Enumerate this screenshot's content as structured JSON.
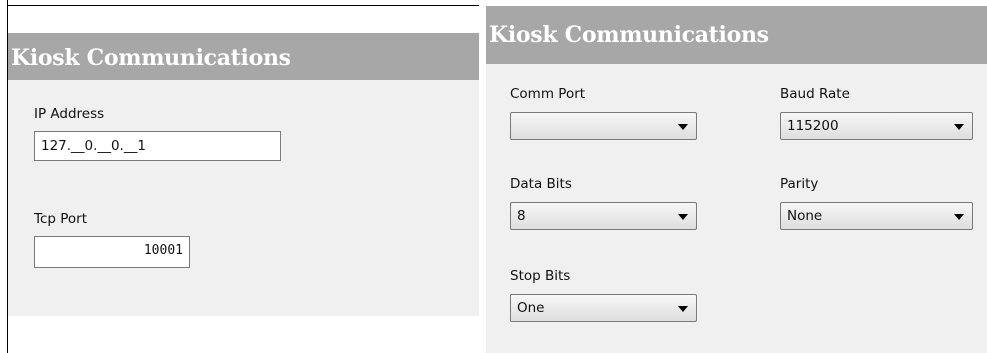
{
  "left_panel": {
    "title": "Kiosk Communications",
    "ip_address": {
      "label": "IP Address",
      "value": "127.__0.__0.__1"
    },
    "tcp_port": {
      "label": "Tcp Port",
      "value": "10001"
    }
  },
  "right_panel": {
    "title": "Kiosk Communications",
    "comm_port": {
      "label": "Comm Port",
      "value": ""
    },
    "baud_rate": {
      "label": "Baud Rate",
      "value": "115200"
    },
    "data_bits": {
      "label": "Data Bits",
      "value": "8"
    },
    "parity": {
      "label": "Parity",
      "value": "None"
    },
    "stop_bits": {
      "label": "Stop Bits",
      "value": "One"
    }
  },
  "icons": {
    "dropdown": "chevron-down-icon"
  }
}
